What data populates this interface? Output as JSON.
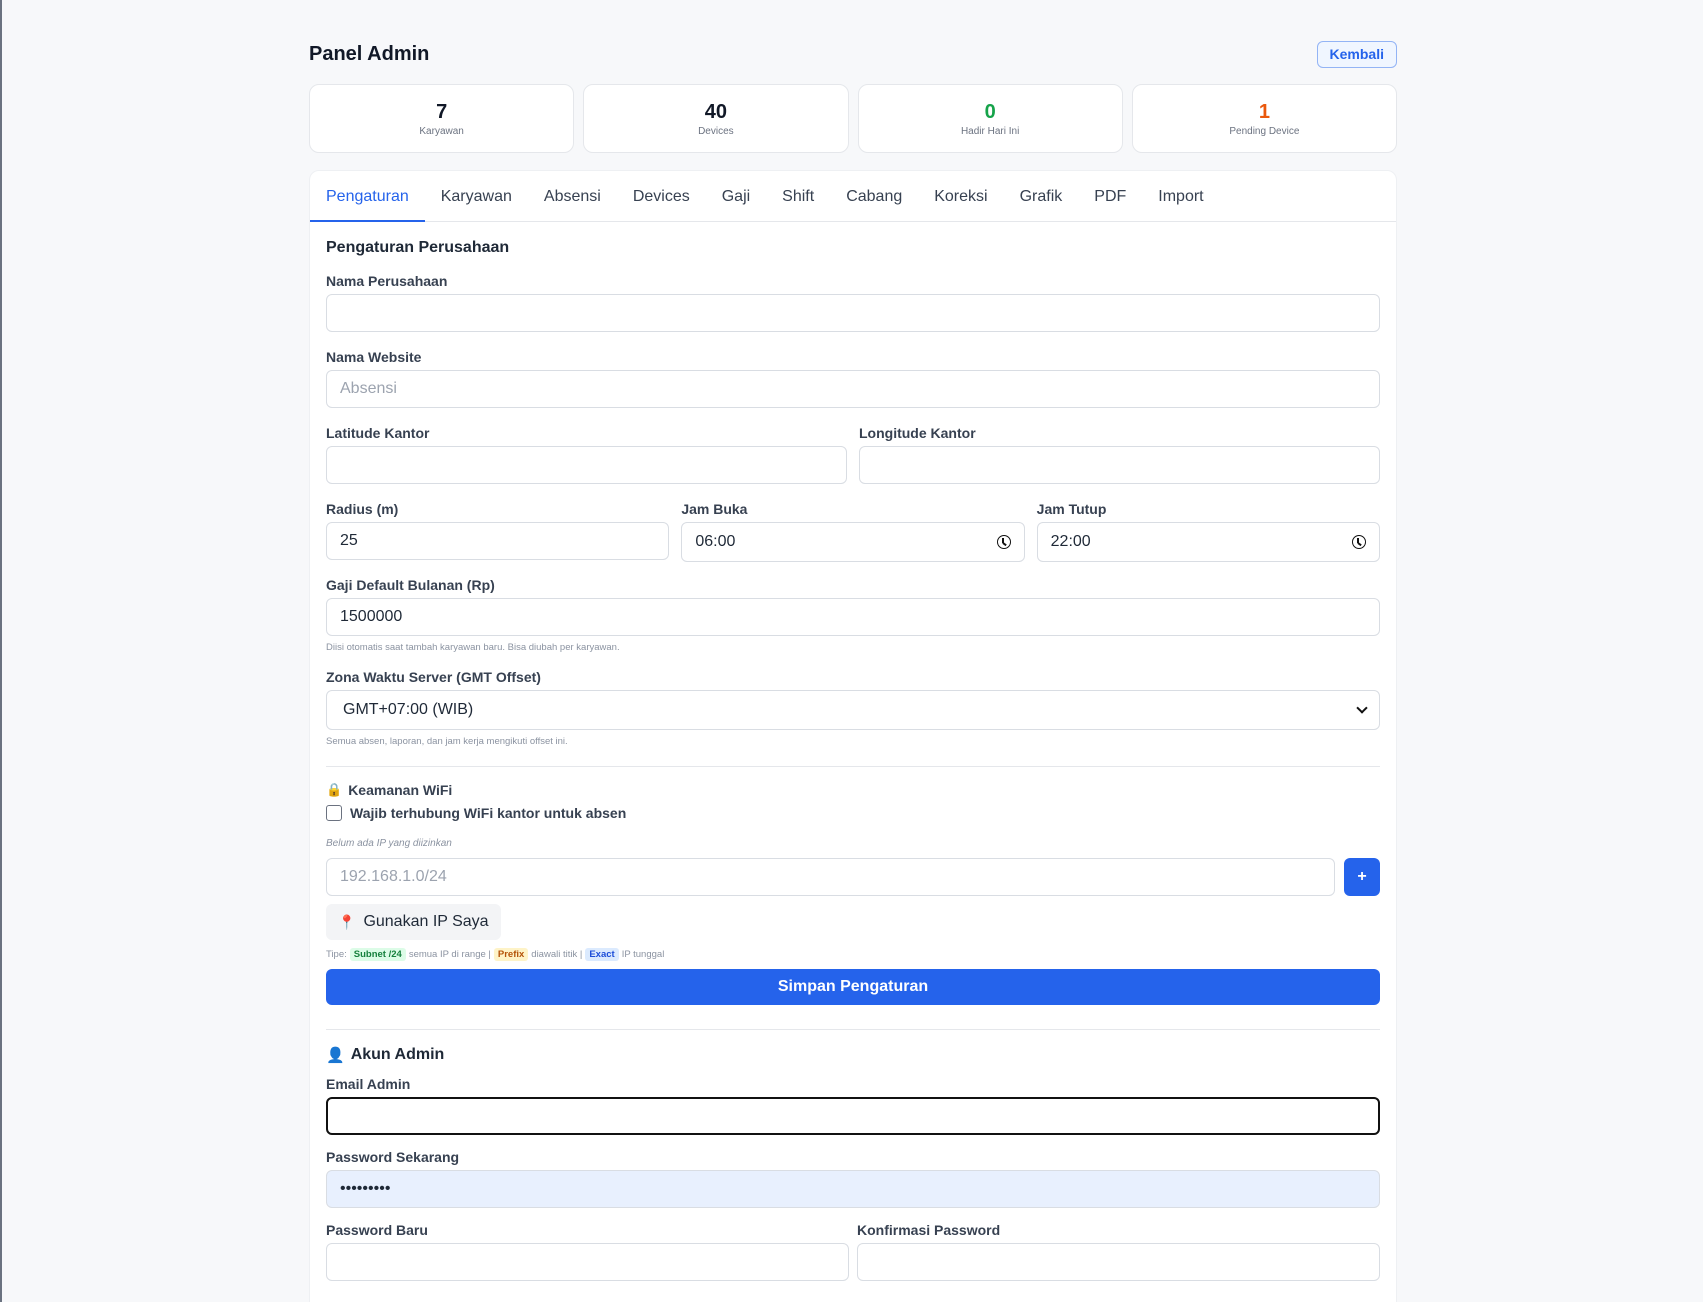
{
  "header": {
    "title": "Panel Admin",
    "back_label": "Kembali"
  },
  "stats": [
    {
      "value": "7",
      "label": "Karyawan",
      "color": "#111827"
    },
    {
      "value": "40",
      "label": "Devices",
      "color": "#111827"
    },
    {
      "value": "0",
      "label": "Hadir Hari Ini",
      "color": "#16a34a"
    },
    {
      "value": "1",
      "label": "Pending Device",
      "color": "#ea580c"
    }
  ],
  "tabs": [
    "Pengaturan",
    "Karyawan",
    "Absensi",
    "Devices",
    "Gaji",
    "Shift",
    "Cabang",
    "Koreksi",
    "Grafik",
    "PDF",
    "Import"
  ],
  "active_tab": "Pengaturan",
  "company": {
    "section_title": "Pengaturan Perusahaan",
    "name_label": "Nama Perusahaan",
    "name_value": "",
    "website_label": "Nama Website",
    "website_placeholder": "Absensi",
    "lat_label": "Latitude Kantor",
    "lat_value": "",
    "lng_label": "Longitude Kantor",
    "lng_value": "",
    "radius_label": "Radius (m)",
    "radius_value": "25",
    "open_label": "Jam Buka",
    "open_value": "06:00",
    "close_label": "Jam Tutup",
    "close_value": "22:00",
    "salary_label": "Gaji Default Bulanan (Rp)",
    "salary_value": "1500000",
    "salary_hint": "Diisi otomatis saat tambah karyawan baru. Bisa diubah per karyawan.",
    "tz_label": "Zona Waktu Server (GMT Offset)",
    "tz_value": "GMT+07:00 (WIB)",
    "tz_hint": "Semua absen, laporan, dan jam kerja mengikuti offset ini."
  },
  "wifi": {
    "title": "Keamanan WiFi",
    "checkbox_label": "Wajib terhubung WiFi kantor untuk absen",
    "empty_note": "Belum ada IP yang diizinkan",
    "ip_placeholder": "192.168.1.0/24",
    "add_label": "+",
    "my_ip_label": "Gunakan IP Saya",
    "types_prefix": "Tipe:",
    "type_subnet": "Subnet /24",
    "type_subnet_desc": "semua IP di range |",
    "type_prefix": "Prefix",
    "type_prefix_desc": "diawali titik |",
    "type_exact": "Exact",
    "type_exact_desc": "IP tunggal"
  },
  "save_label": "Simpan Pengaturan",
  "admin": {
    "title": "Akun Admin",
    "email_label": "Email Admin",
    "email_value": "",
    "current_pw_label": "Password Sekarang",
    "current_pw_value": "•••••••••",
    "new_pw_label": "Password Baru",
    "confirm_pw_label": "Konfirmasi Password"
  }
}
